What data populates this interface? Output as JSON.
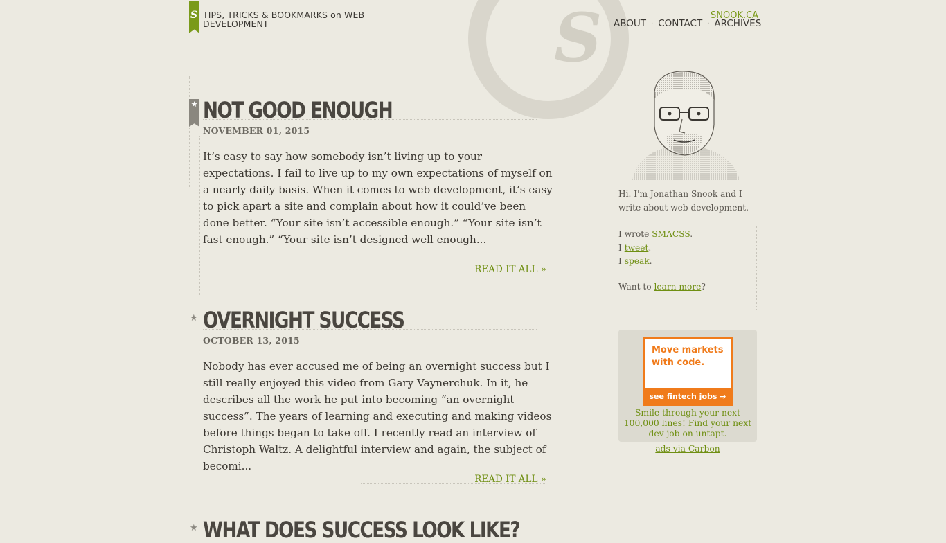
{
  "header": {
    "tagline": "TIPS, TRICKS & BOOKMARKS on WEB DEVELOPMENT",
    "logo_letter": "S",
    "site_name": "SNOOK.CA",
    "nav": [
      "ABOUT",
      "CONTACT",
      "ARCHIVES"
    ],
    "nav_separator": "·"
  },
  "posts": [
    {
      "title": "NOT GOOD ENOUGH",
      "date": "NOVEMBER 01, 2015",
      "excerpt": "It’s easy to say how somebody isn’t living up to your expectations. I fail to live up to my own expectations of myself on a nearly daily basis. When it comes to web development, it’s easy to pick apart a site and complain about how it could’ve been done better. “Your site isn’t accessible enough.” “Your site isn’t fast enough.” “Your site isn’t designed well enough...",
      "read_more": "READ IT ALL »"
    },
    {
      "title": "OVERNIGHT SUCCESS",
      "date": "OCTOBER 13, 2015",
      "excerpt": "Nobody has ever accused me of being an overnight success but I still really enjoyed this video from Gary Vaynerchuk. In it, he describes all the work he put into becoming “an overnight success”. The years of learning and executing and making videos before things began to take off. I recently read an interview of Christoph Waltz. A delightful interview and again, the subject of becomi...",
      "read_more": "READ IT ALL »"
    },
    {
      "title": "WHAT DOES SUCCESS LOOK LIKE?"
    }
  ],
  "sidebar": {
    "bio": "Hi. I'm Jonathan Snook and I write about web development.",
    "links": [
      {
        "prefix": "I wrote ",
        "link": "SMACSS",
        "suffix": "."
      },
      {
        "prefix": "I ",
        "link": "tweet",
        "suffix": "."
      },
      {
        "prefix": "I ",
        "link": "speak",
        "suffix": "."
      }
    ],
    "more_prefix": "Want to ",
    "more_link": "learn more",
    "more_suffix": "?"
  },
  "ad": {
    "headline": "Move markets with code.",
    "cta": "see fintech jobs ➔",
    "text": "Smile through your next 100,000 lines! Find your next dev job on untapt.",
    "via": "ads via Carbon"
  },
  "colors": {
    "background": "#eceae1",
    "accent_green": "#7a9a1a",
    "ad_orange": "#f07b1b",
    "text": "#3e3a34"
  }
}
